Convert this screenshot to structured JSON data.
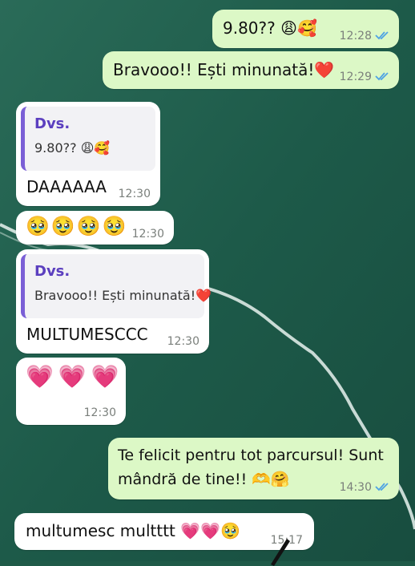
{
  "messages": [
    {
      "text": "9.80?? 😩🥰",
      "time": "12:28"
    },
    {
      "text": "Bravooo!! Ești minunată!❤️",
      "time": "12:29"
    },
    {
      "reply_author": "Dvs.",
      "reply_text": "9.80?? 😩🥰",
      "text": "DAAAAAA",
      "time": "12:30"
    },
    {
      "text": "🥹🥹🥹🥹",
      "time": "12:30"
    },
    {
      "reply_author": "Dvs.",
      "reply_text": "Bravooo!! Ești minunată!❤️",
      "text": "MULTUMESCCC",
      "time": "12:30"
    },
    {
      "text": "💗💗💗",
      "time": "12:30"
    },
    {
      "text_line1": "Te felicit pentru tot parcursul! Sunt",
      "text_line2": "mândră de tine!! 🫶🤗",
      "time": "14:30"
    },
    {
      "text": "multumesc multttt 💗💗🥹",
      "time": "15:17"
    }
  ],
  "colors": {
    "outgoing_bubble": "#dcf8c6",
    "incoming_bubble": "#ffffff",
    "read_ticks": "#4fa3e3",
    "reply_author": "#5b3fbf",
    "wallpaper": "#1f5a48"
  }
}
